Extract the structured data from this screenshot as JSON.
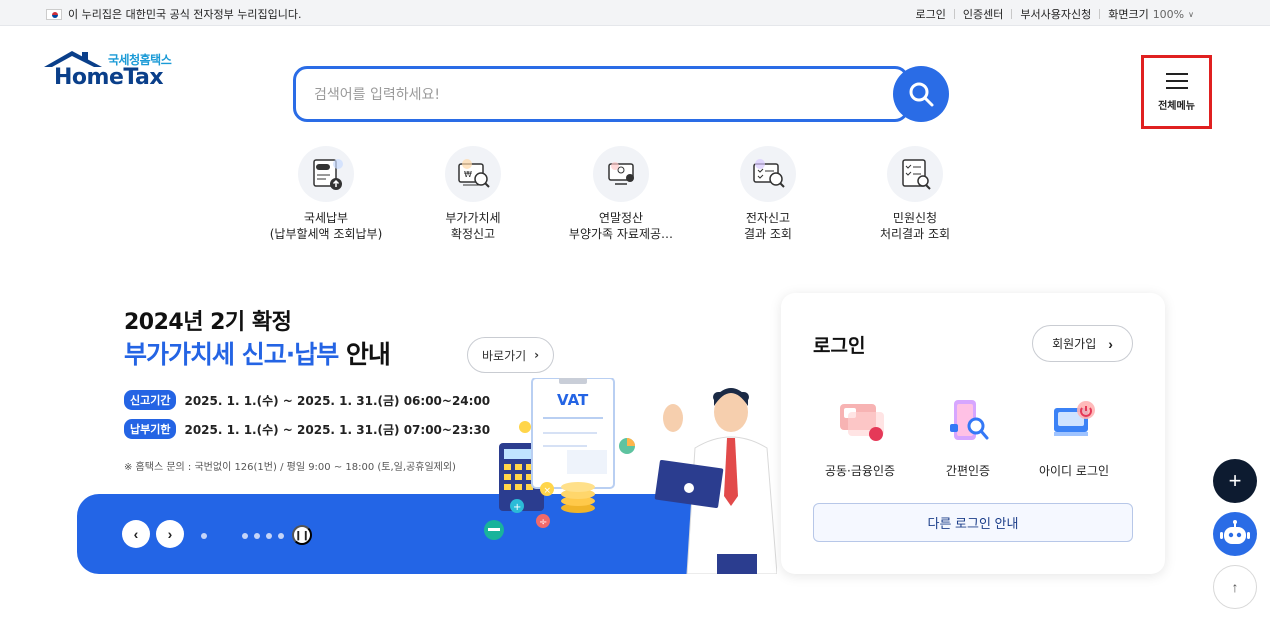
{
  "topbar": {
    "gov_notice": "이 누리집은 대한민국 공식 전자정부 누리집입니다.",
    "links": [
      "로그인",
      "인증센터",
      "부서사용자신청"
    ],
    "zoom_label": "화면크기",
    "zoom_value": "100%"
  },
  "logo": {
    "korean": "국세청홈택스",
    "english": "HomeTax"
  },
  "search": {
    "placeholder": "검색어를 입력하세요!"
  },
  "all_menu": {
    "label": "전체메뉴"
  },
  "quick_menu": [
    {
      "label": "국세납부\n(납부할세액 조회납부)",
      "icon": "tax-payment-icon"
    },
    {
      "label": "부가가치세\n확정신고",
      "icon": "vat-report-icon"
    },
    {
      "label": "연말정산\n부양가족 자료제공…",
      "icon": "year-end-settlement-icon"
    },
    {
      "label": "전자신고\n결과 조회",
      "icon": "e-filing-result-icon"
    },
    {
      "label": "민원신청\n처리결과 조회",
      "icon": "civil-petition-icon"
    }
  ],
  "banner": {
    "title_line1": "2024년 2기 확정",
    "title_blue": "부가가치세 신고·납부",
    "title_black": "안내",
    "go_button": "바로가기",
    "periods": [
      {
        "badge": "신고기간",
        "text": "2025. 1. 1.(수) ~ 2025. 1. 31.(금) 06:00~24:00"
      },
      {
        "badge": "납부기한",
        "text": "2025. 1. 1.(수) ~ 2025. 1. 31.(금) 07:00~23:30"
      }
    ],
    "note": "※ 홈택스 문의 : 국번없이 126(1번) / 평일 9:00 ~ 18:00 (토,일,공휴일제외)",
    "vat_label": "VAT",
    "slide_count": 6,
    "active_slide": 1
  },
  "login": {
    "title": "로그인",
    "signup_button": "회원가입",
    "options": [
      {
        "label": "공동·금융인증",
        "icon": "certificate-icon"
      },
      {
        "label": "간편인증",
        "icon": "simple-auth-icon"
      },
      {
        "label": "아이디 로그인",
        "icon": "id-login-icon"
      }
    ],
    "other_login_button": "다른 로그인 안내"
  },
  "colors": {
    "primary": "#2a6ce6",
    "highlight_border": "#e02020",
    "dark": "#0d1b30"
  }
}
